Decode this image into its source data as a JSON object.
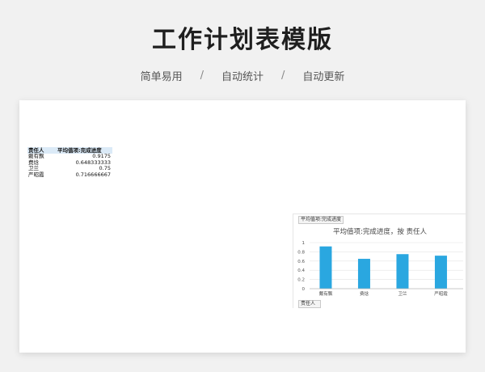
{
  "hero": {
    "title": "工作计划表模版",
    "features": [
      "简单易用",
      "自动统计",
      "自动更新"
    ],
    "separator": "/"
  },
  "pivot_table": {
    "headers": [
      "责任人",
      "平均值项:完成进度"
    ],
    "rows": [
      {
        "name": "戴有飘",
        "value": "0.9175"
      },
      {
        "name": "费焓",
        "value": "0.648333333"
      },
      {
        "name": "卫兰",
        "value": "0.75"
      },
      {
        "name": "严昭霞",
        "value": "0.716666667"
      }
    ]
  },
  "chart": {
    "value_field_button": "平均值项:完成进度",
    "axis_field_button": "责任人"
  },
  "colors": {
    "bar": "#2aa7e0",
    "header_fill": "#dbeaf7"
  },
  "chart_data": {
    "type": "bar",
    "title": "平均值项:完成进度，按 责任人",
    "categories": [
      "戴有飘",
      "费焓",
      "卫兰",
      "严昭霞"
    ],
    "values": [
      0.9175,
      0.648333333,
      0.75,
      0.716666667
    ],
    "ylim": [
      0,
      1
    ],
    "yticks": [
      "0",
      "0.2",
      "0.4",
      "0.6",
      "0.8",
      "1"
    ],
    "grid": true,
    "legend": "none"
  }
}
